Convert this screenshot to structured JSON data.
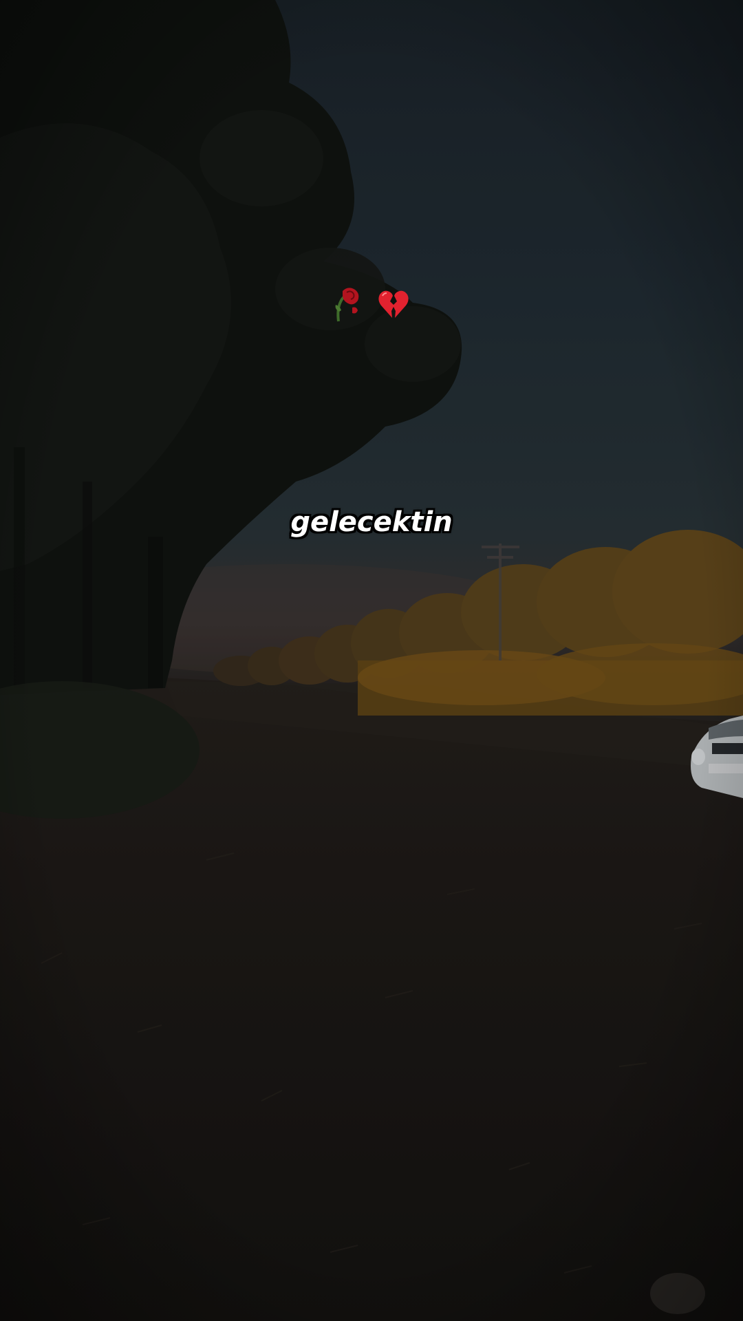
{
  "caption": {
    "emoji_text": "🥀💔",
    "icons": [
      "wilted-rose-icon",
      "broken-heart-icon"
    ],
    "emoji_color": "#d01a26"
  },
  "subtitle": {
    "text": "gelecektin",
    "color": "#ffffff",
    "outline_color": "#000000"
  },
  "scene": {
    "sky_color": "#27323a",
    "ground_color": "#1c1916",
    "foliage_color": "#7a5a20"
  }
}
